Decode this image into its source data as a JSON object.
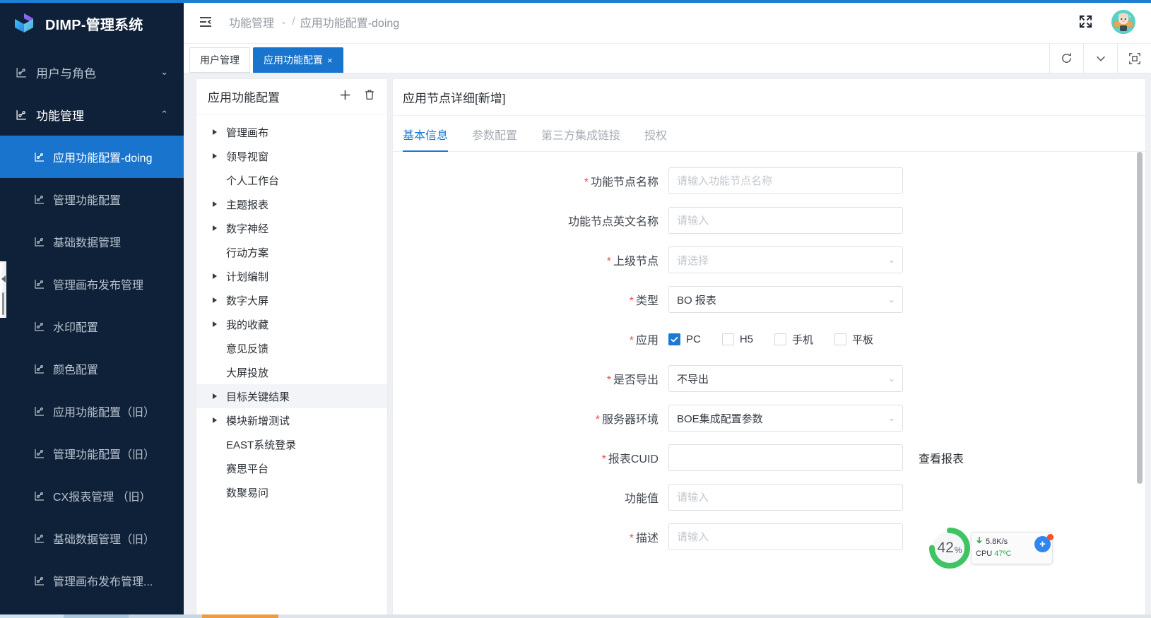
{
  "brand": {
    "title": "DIMP-管理系统"
  },
  "sidebar": {
    "groups": [
      {
        "label": "用户与角色",
        "icon": "node-chart-icon",
        "expanded": false,
        "chevron": "⌄"
      },
      {
        "label": "功能管理",
        "icon": "node-chart-icon",
        "expanded": true,
        "chevron": "⌃"
      }
    ],
    "items": [
      {
        "label": "应用功能配置-doing",
        "icon": "node-chart-icon",
        "active": true
      },
      {
        "label": "管理功能配置",
        "icon": "node-chart-icon",
        "active": false
      },
      {
        "label": "基础数据管理",
        "icon": "node-chart-icon",
        "active": false
      },
      {
        "label": "管理画布发布管理",
        "icon": "node-chart-icon",
        "active": false
      },
      {
        "label": "水印配置",
        "icon": "node-chart-icon",
        "active": false
      },
      {
        "label": "颜色配置",
        "icon": "node-chart-icon",
        "active": false
      },
      {
        "label": "应用功能配置（旧）",
        "icon": "node-chart-icon",
        "active": false
      },
      {
        "label": "管理功能配置（旧）",
        "icon": "node-chart-icon",
        "active": false
      },
      {
        "label": "CX报表管理 （旧）",
        "icon": "node-chart-icon",
        "active": false
      },
      {
        "label": "基础数据管理（旧）",
        "icon": "node-chart-icon",
        "active": false
      },
      {
        "label": "管理画布发布管理...",
        "icon": "node-chart-icon",
        "active": false
      }
    ]
  },
  "topbar": {
    "menu_fold_icon": "menu-fold-icon",
    "breadcrumb": {
      "parent": "功能管理",
      "parent_chevron": "⌄",
      "separator": "/",
      "current": "应用功能配置-doing"
    },
    "fullscreen_icon": "expand-icon",
    "avatar_alt": "user-avatar"
  },
  "tabs": {
    "items": [
      {
        "label": "用户管理",
        "active": false,
        "closable": false
      },
      {
        "label": "应用功能配置",
        "active": true,
        "closable": true,
        "close": "×"
      }
    ],
    "actions": [
      {
        "name": "refresh-button",
        "glyph": "refresh-icon"
      },
      {
        "name": "tab-dropdown-button",
        "glyph": "chevron-down-icon"
      },
      {
        "name": "content-fullscreen-button",
        "glyph": "fullscreen-frame-icon"
      }
    ]
  },
  "tree": {
    "title": "应用功能配置",
    "add_icon": "plus-icon",
    "delete_icon": "trash-icon",
    "nodes": [
      {
        "label": "管理画布",
        "expandable": true,
        "highlighted": false
      },
      {
        "label": "领导视窗",
        "expandable": true,
        "highlighted": false
      },
      {
        "label": "个人工作台",
        "expandable": false,
        "highlighted": false
      },
      {
        "label": "主题报表",
        "expandable": true,
        "highlighted": false
      },
      {
        "label": "数字神经",
        "expandable": true,
        "highlighted": false
      },
      {
        "label": "行动方案",
        "expandable": false,
        "highlighted": false
      },
      {
        "label": "计划编制",
        "expandable": true,
        "highlighted": false
      },
      {
        "label": "数字大屏",
        "expandable": true,
        "highlighted": false
      },
      {
        "label": "我的收藏",
        "expandable": true,
        "highlighted": false
      },
      {
        "label": "意见反馈",
        "expandable": false,
        "highlighted": false
      },
      {
        "label": "大屏投放",
        "expandable": false,
        "highlighted": false
      },
      {
        "label": "目标关键结果",
        "expandable": true,
        "highlighted": true
      },
      {
        "label": "模块新增测试",
        "expandable": true,
        "highlighted": false
      },
      {
        "label": "EAST系统登录",
        "expandable": false,
        "highlighted": false
      },
      {
        "label": "赛思平台",
        "expandable": false,
        "highlighted": false
      },
      {
        "label": "数聚易问",
        "expandable": false,
        "highlighted": false
      }
    ]
  },
  "detail": {
    "title": "应用节点详细[新增]",
    "tabs": [
      {
        "label": "基本信息",
        "active": true
      },
      {
        "label": "参数配置",
        "active": false
      },
      {
        "label": "第三方集成链接",
        "active": false
      },
      {
        "label": "授权",
        "active": false
      }
    ],
    "fields": [
      {
        "name": "node-name",
        "label": "功能节点名称",
        "required": true,
        "type": "input",
        "value": "",
        "placeholder": "请输入功能节点名称"
      },
      {
        "name": "node-name-en",
        "label": "功能节点英文名称",
        "required": false,
        "type": "input",
        "value": "",
        "placeholder": "请输入"
      },
      {
        "name": "parent-node",
        "label": "上级节点",
        "required": true,
        "type": "select",
        "value": "",
        "placeholder": "请选择"
      },
      {
        "name": "type",
        "label": "类型",
        "required": true,
        "type": "select",
        "value": "BO 报表",
        "placeholder": ""
      },
      {
        "name": "application",
        "label": "应用",
        "required": true,
        "type": "checkbox-group"
      },
      {
        "name": "exportable",
        "label": "是否导出",
        "required": true,
        "type": "select",
        "value": "不导出",
        "placeholder": ""
      },
      {
        "name": "server-env",
        "label": "服务器环境",
        "required": true,
        "type": "select",
        "value": "BOE集成配置参数",
        "placeholder": ""
      },
      {
        "name": "report-cuid",
        "label": "报表CUID",
        "required": true,
        "type": "input",
        "value": "",
        "placeholder": "",
        "side_link": "查看报表"
      },
      {
        "name": "feature-value",
        "label": "功能值",
        "required": false,
        "type": "input",
        "value": "",
        "placeholder": "请输入"
      },
      {
        "name": "description",
        "label": "描述",
        "required": true,
        "type": "input",
        "value": "",
        "placeholder": "请输入"
      }
    ],
    "checkboxes": [
      {
        "label": "PC",
        "checked": true
      },
      {
        "label": "H5",
        "checked": false
      },
      {
        "label": "手机",
        "checked": false
      },
      {
        "label": "平板",
        "checked": false
      }
    ],
    "check_glyph": "check-icon",
    "select_chevron": "⌄"
  },
  "monitor": {
    "percent": "42",
    "percent_unit": "%",
    "net_speed": "5.8K/s",
    "net_arrow": "↓",
    "cpu_label": "CPU",
    "cpu_temp": "47ºC",
    "plus": "+",
    "ring_color": "#40c463"
  },
  "colors": {
    "accent": "#1d7fd4",
    "sidebar_bg": "#0e2138",
    "active_item": "#1874cd",
    "required_star": "#e54f4f",
    "tab_active_text": "#1a7ad4"
  }
}
